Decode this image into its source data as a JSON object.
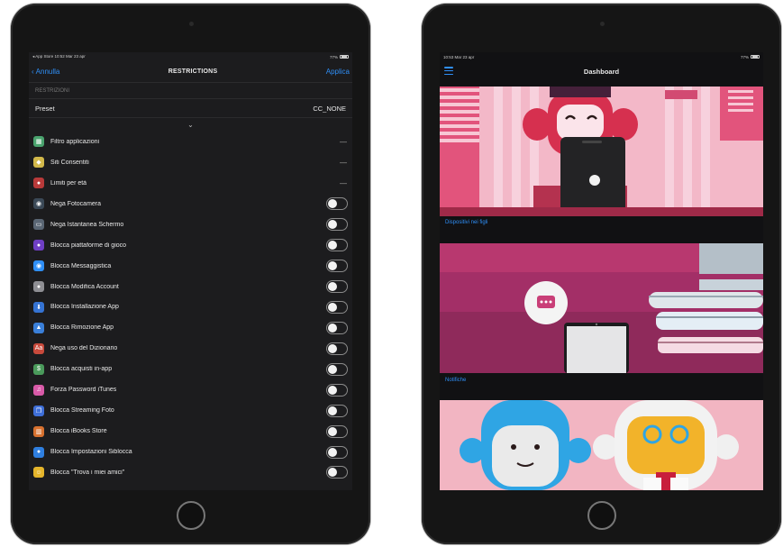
{
  "left_device": {
    "status_bar": {
      "left": "◂ App Store  10:52  Mar 23 apr",
      "right": "77%"
    },
    "nav": {
      "back_label": "Annulla",
      "title": "RESTRICTIONS",
      "apply_label": "Applica"
    },
    "section_title": "RESTRIZIONI",
    "preset": {
      "label": "Preset",
      "value": "CC_NONE"
    },
    "chevron": "⌄",
    "rows": [
      {
        "label": "Filtro applicazioni",
        "icon": "apps-filter-icon",
        "color": "#4aa36e",
        "glyph": "▦",
        "control": "dash",
        "dash": "—"
      },
      {
        "label": "Siti Consentiti",
        "icon": "allowed-sites-icon",
        "color": "#d2b84a",
        "glyph": "◆",
        "control": "dash",
        "dash": "—"
      },
      {
        "label": "Limiti per età",
        "icon": "age-limit-icon",
        "color": "#b83a3a",
        "glyph": "●",
        "control": "dash",
        "dash": "—"
      },
      {
        "label": "Nega Fotocamera",
        "icon": "camera-icon",
        "color": "#3b4957",
        "glyph": "◉",
        "control": "toggle"
      },
      {
        "label": "Nega Istantanea Schermo",
        "icon": "screenshot-icon",
        "color": "#5a6674",
        "glyph": "▭",
        "control": "toggle"
      },
      {
        "label": "Blocca piattaforme di gioco",
        "icon": "game-platform-icon",
        "color": "#6f3fc4",
        "glyph": "●",
        "control": "toggle"
      },
      {
        "label": "Blocca Messaggistica",
        "icon": "messaging-icon",
        "color": "#2f8ff7",
        "glyph": "◉",
        "control": "toggle"
      },
      {
        "label": "Blocca Modifica Account",
        "icon": "account-icon",
        "color": "#8e8e93",
        "glyph": "●",
        "control": "toggle"
      },
      {
        "label": "Blocca Installazione App",
        "icon": "install-app-icon",
        "color": "#3573d3",
        "glyph": "⬇",
        "control": "toggle"
      },
      {
        "label": "Blocca Rimozione App",
        "icon": "remove-app-icon",
        "color": "#3a7fd9",
        "glyph": "▲",
        "control": "toggle"
      },
      {
        "label": "Nega uso del Dizionario",
        "icon": "dictionary-icon",
        "color": "#c84a3c",
        "glyph": "Aa",
        "control": "toggle"
      },
      {
        "label": "Blocca acquisti in-app",
        "icon": "in-app-purchase-icon",
        "color": "#4a9a5b",
        "glyph": "$",
        "control": "toggle"
      },
      {
        "label": "Forza Password iTunes",
        "icon": "itunes-icon",
        "color": "#d85aa8",
        "glyph": "♫",
        "control": "toggle"
      },
      {
        "label": "Blocca Streaming Foto",
        "icon": "photo-streaming-icon",
        "color": "#3f6fd8",
        "glyph": "❐",
        "control": "toggle"
      },
      {
        "label": "Blocca iBooks Store",
        "icon": "ibooks-icon",
        "color": "#d8712f",
        "glyph": "▥",
        "control": "toggle"
      },
      {
        "label": "Blocca Impostazioni Siblocca",
        "icon": "settings-lock-icon",
        "color": "#2f7fe0",
        "glyph": "●",
        "control": "toggle"
      },
      {
        "label": "Blocca \"Trova i miei amici\"",
        "icon": "find-friends-icon",
        "color": "#e5b52b",
        "glyph": "☺",
        "control": "toggle"
      }
    ]
  },
  "right_device": {
    "status_bar": {
      "left": "10:53  Mar 23 apr",
      "right": "77%"
    },
    "nav": {
      "title": "Dashboard"
    },
    "cards": [
      {
        "caption": "Dispositivi nei figli"
      },
      {
        "caption": "Notifiche"
      },
      {
        "caption": ""
      }
    ]
  }
}
